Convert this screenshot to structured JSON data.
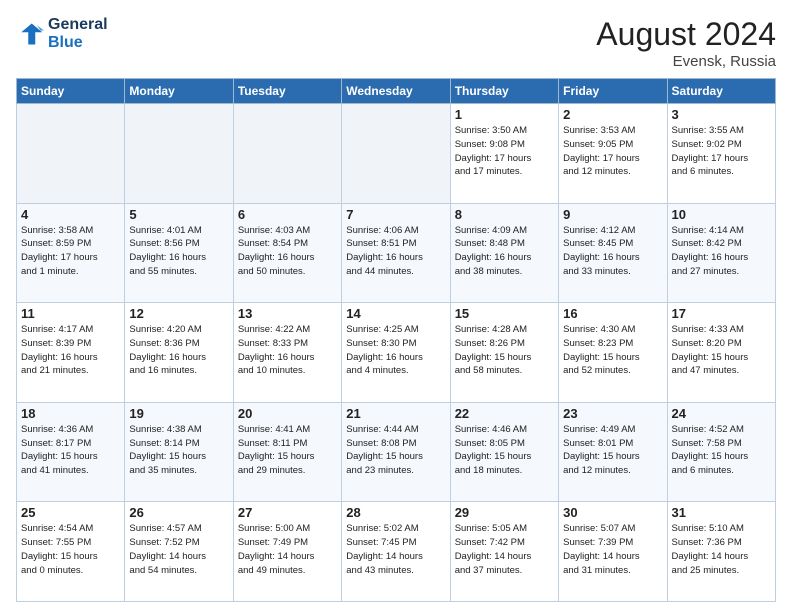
{
  "logo": {
    "line1": "General",
    "line2": "Blue"
  },
  "header": {
    "month_year": "August 2024",
    "location": "Evensk, Russia"
  },
  "days_of_week": [
    "Sunday",
    "Monday",
    "Tuesday",
    "Wednesday",
    "Thursday",
    "Friday",
    "Saturday"
  ],
  "weeks": [
    [
      {
        "day": "",
        "info": ""
      },
      {
        "day": "",
        "info": ""
      },
      {
        "day": "",
        "info": ""
      },
      {
        "day": "",
        "info": ""
      },
      {
        "day": "1",
        "info": "Sunrise: 3:50 AM\nSunset: 9:08 PM\nDaylight: 17 hours\nand 17 minutes."
      },
      {
        "day": "2",
        "info": "Sunrise: 3:53 AM\nSunset: 9:05 PM\nDaylight: 17 hours\nand 12 minutes."
      },
      {
        "day": "3",
        "info": "Sunrise: 3:55 AM\nSunset: 9:02 PM\nDaylight: 17 hours\nand 6 minutes."
      }
    ],
    [
      {
        "day": "4",
        "info": "Sunrise: 3:58 AM\nSunset: 8:59 PM\nDaylight: 17 hours\nand 1 minute."
      },
      {
        "day": "5",
        "info": "Sunrise: 4:01 AM\nSunset: 8:56 PM\nDaylight: 16 hours\nand 55 minutes."
      },
      {
        "day": "6",
        "info": "Sunrise: 4:03 AM\nSunset: 8:54 PM\nDaylight: 16 hours\nand 50 minutes."
      },
      {
        "day": "7",
        "info": "Sunrise: 4:06 AM\nSunset: 8:51 PM\nDaylight: 16 hours\nand 44 minutes."
      },
      {
        "day": "8",
        "info": "Sunrise: 4:09 AM\nSunset: 8:48 PM\nDaylight: 16 hours\nand 38 minutes."
      },
      {
        "day": "9",
        "info": "Sunrise: 4:12 AM\nSunset: 8:45 PM\nDaylight: 16 hours\nand 33 minutes."
      },
      {
        "day": "10",
        "info": "Sunrise: 4:14 AM\nSunset: 8:42 PM\nDaylight: 16 hours\nand 27 minutes."
      }
    ],
    [
      {
        "day": "11",
        "info": "Sunrise: 4:17 AM\nSunset: 8:39 PM\nDaylight: 16 hours\nand 21 minutes."
      },
      {
        "day": "12",
        "info": "Sunrise: 4:20 AM\nSunset: 8:36 PM\nDaylight: 16 hours\nand 16 minutes."
      },
      {
        "day": "13",
        "info": "Sunrise: 4:22 AM\nSunset: 8:33 PM\nDaylight: 16 hours\nand 10 minutes."
      },
      {
        "day": "14",
        "info": "Sunrise: 4:25 AM\nSunset: 8:30 PM\nDaylight: 16 hours\nand 4 minutes."
      },
      {
        "day": "15",
        "info": "Sunrise: 4:28 AM\nSunset: 8:26 PM\nDaylight: 15 hours\nand 58 minutes."
      },
      {
        "day": "16",
        "info": "Sunrise: 4:30 AM\nSunset: 8:23 PM\nDaylight: 15 hours\nand 52 minutes."
      },
      {
        "day": "17",
        "info": "Sunrise: 4:33 AM\nSunset: 8:20 PM\nDaylight: 15 hours\nand 47 minutes."
      }
    ],
    [
      {
        "day": "18",
        "info": "Sunrise: 4:36 AM\nSunset: 8:17 PM\nDaylight: 15 hours\nand 41 minutes."
      },
      {
        "day": "19",
        "info": "Sunrise: 4:38 AM\nSunset: 8:14 PM\nDaylight: 15 hours\nand 35 minutes."
      },
      {
        "day": "20",
        "info": "Sunrise: 4:41 AM\nSunset: 8:11 PM\nDaylight: 15 hours\nand 29 minutes."
      },
      {
        "day": "21",
        "info": "Sunrise: 4:44 AM\nSunset: 8:08 PM\nDaylight: 15 hours\nand 23 minutes."
      },
      {
        "day": "22",
        "info": "Sunrise: 4:46 AM\nSunset: 8:05 PM\nDaylight: 15 hours\nand 18 minutes."
      },
      {
        "day": "23",
        "info": "Sunrise: 4:49 AM\nSunset: 8:01 PM\nDaylight: 15 hours\nand 12 minutes."
      },
      {
        "day": "24",
        "info": "Sunrise: 4:52 AM\nSunset: 7:58 PM\nDaylight: 15 hours\nand 6 minutes."
      }
    ],
    [
      {
        "day": "25",
        "info": "Sunrise: 4:54 AM\nSunset: 7:55 PM\nDaylight: 15 hours\nand 0 minutes."
      },
      {
        "day": "26",
        "info": "Sunrise: 4:57 AM\nSunset: 7:52 PM\nDaylight: 14 hours\nand 54 minutes."
      },
      {
        "day": "27",
        "info": "Sunrise: 5:00 AM\nSunset: 7:49 PM\nDaylight: 14 hours\nand 49 minutes."
      },
      {
        "day": "28",
        "info": "Sunrise: 5:02 AM\nSunset: 7:45 PM\nDaylight: 14 hours\nand 43 minutes."
      },
      {
        "day": "29",
        "info": "Sunrise: 5:05 AM\nSunset: 7:42 PM\nDaylight: 14 hours\nand 37 minutes."
      },
      {
        "day": "30",
        "info": "Sunrise: 5:07 AM\nSunset: 7:39 PM\nDaylight: 14 hours\nand 31 minutes."
      },
      {
        "day": "31",
        "info": "Sunrise: 5:10 AM\nSunset: 7:36 PM\nDaylight: 14 hours\nand 25 minutes."
      }
    ]
  ]
}
